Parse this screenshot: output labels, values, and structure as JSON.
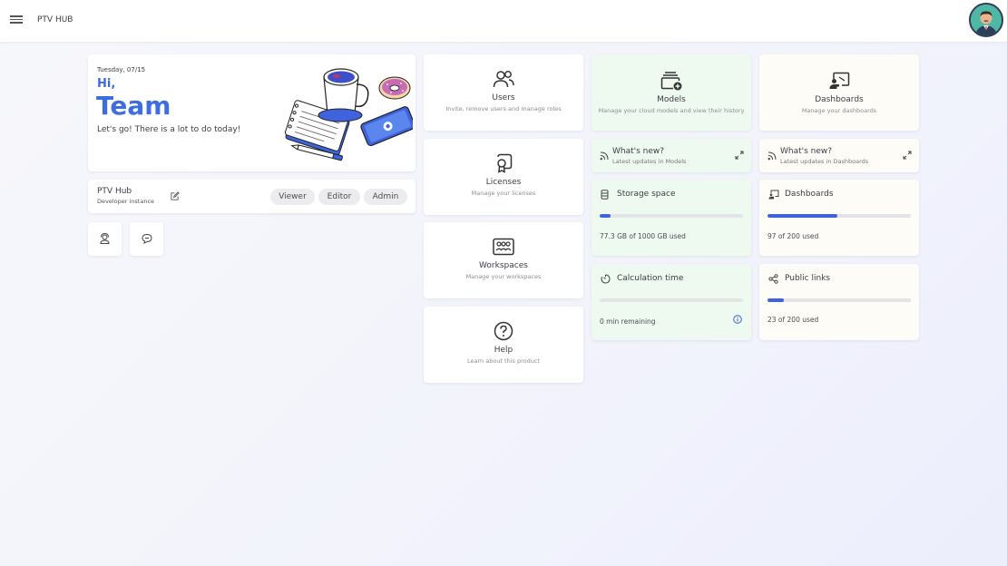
{
  "app": {
    "title": "PTV HUB"
  },
  "greeting": {
    "date": "Tuesday, 07/15",
    "hi": "Hi,",
    "name": "Team",
    "tagline": "Let's go! There is a lot to do today!"
  },
  "instance": {
    "name": "PTV Hub",
    "subtitle": "Developer instance",
    "roles": [
      "Viewer",
      "Editor",
      "Admin"
    ]
  },
  "nav": {
    "users": {
      "title": "Users",
      "subtitle": "Invite, remove users and manage roles"
    },
    "licenses": {
      "title": "Licenses",
      "subtitle": "Manage your licenses"
    },
    "workspaces": {
      "title": "Workspaces",
      "subtitle": "Manage your workspaces"
    },
    "help": {
      "title": "Help",
      "subtitle": "Learn about this product"
    },
    "models": {
      "title": "Models",
      "subtitle": "Manage your cloud models and view their history"
    },
    "dashboards": {
      "title": "Dashboards",
      "subtitle": "Manage your dashboards"
    }
  },
  "whats_new": {
    "models": {
      "title": "What's new?",
      "subtitle": "Latest updates in Models"
    },
    "dashboards": {
      "title": "What's new?",
      "subtitle": "Latest updates in Dashboards"
    }
  },
  "usage": {
    "storage": {
      "title": "Storage space",
      "text": "77.3 GB of 1000 GB used",
      "fraction": 0.0773
    },
    "calc": {
      "title": "Calculation time",
      "text": "0 min remaining",
      "fraction": 0
    },
    "dashboards": {
      "title": "Dashboards",
      "text": "97 of 200 used",
      "fraction": 0.485
    },
    "links": {
      "title": "Public links",
      "text": "23 of 200 used",
      "fraction": 0.115
    }
  },
  "colors": {
    "accent": "#3e6de0",
    "bar_fill": "#3e63dd",
    "models_tint": "#eefaf0",
    "dashboards_tint": "#fdfcf6"
  },
  "icons": {
    "menu": "hamburger-icon",
    "avatar": "user-avatar",
    "edit": "pencil-edit-icon",
    "support": "support-agent-icon",
    "feedback": "chat-bubble-icon",
    "users": "users-icon",
    "licenses": "license-badge-icon",
    "workspaces": "workspaces-icon",
    "help": "help-circle-icon",
    "models": "models-stack-icon",
    "dashboards": "dashboard-presentation-icon",
    "rss": "rss-feed-icon",
    "external": "expand-arrows-icon",
    "storage": "database-icon",
    "timer": "timer-icon",
    "links": "share-links-icon",
    "info": "info-icon"
  }
}
